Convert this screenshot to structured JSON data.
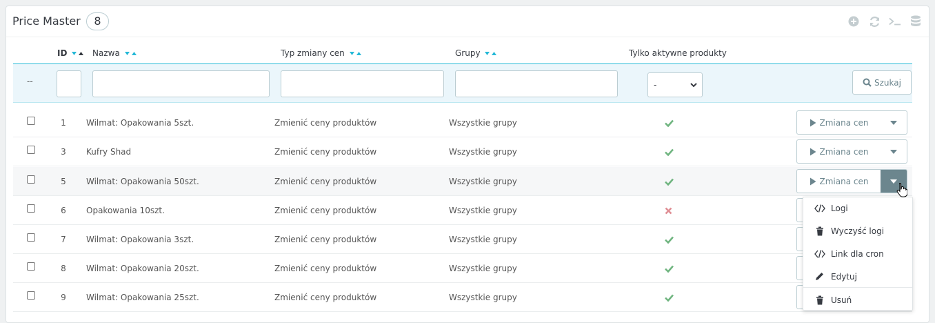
{
  "header": {
    "title": "Price Master",
    "count": "8",
    "toolbar": [
      {
        "name": "add-icon"
      },
      {
        "name": "refresh-icon"
      },
      {
        "name": "terminal-icon"
      },
      {
        "name": "database-icon"
      }
    ]
  },
  "columns": {
    "id": "ID",
    "name": "Nazwa",
    "type": "Typ zmiany cen",
    "groups": "Grupy",
    "active": "Tylko aktywne produkty"
  },
  "filters": {
    "placeholder_dash": "--",
    "id_value": "",
    "name_value": "",
    "type_value": "",
    "groups_value": "",
    "active_selected": "-",
    "search_label": "Szukaj"
  },
  "rows": [
    {
      "id": "1",
      "name": "Wilmat: Opakowania 5szt.",
      "type": "Zmienić ceny produktów",
      "group": "Wszystkie grupy",
      "active": true
    },
    {
      "id": "3",
      "name": "Kufry Shad",
      "type": "Zmienić ceny produktów",
      "group": "Wszystkie grupy",
      "active": true
    },
    {
      "id": "5",
      "name": "Wilmat: Opakowania 50szt.",
      "type": "Zmienić ceny produktów",
      "group": "Wszystkie grupy",
      "active": true
    },
    {
      "id": "6",
      "name": "Opakowania 10szt.",
      "type": "Zmienić ceny produktów",
      "group": "Wszystkie grupy",
      "active": false
    },
    {
      "id": "7",
      "name": "Wilmat: Opakowania 3szt.",
      "type": "Zmienić ceny produktów",
      "group": "Wszystkie grupy",
      "active": true
    },
    {
      "id": "8",
      "name": "Wilmat: Opakowania 20szt.",
      "type": "Zmienić ceny produktów",
      "group": "Wszystkie grupy",
      "active": true
    },
    {
      "id": "9",
      "name": "Wilmat: Opakowania 25szt.",
      "type": "Zmienić ceny produktów",
      "group": "Wszystkie grupy",
      "active": true
    }
  ],
  "row_action_label": "Zmiana cen",
  "dropdown": {
    "items": [
      {
        "label": "Logi",
        "icon": "code-icon"
      },
      {
        "label": "Wyczyść logi",
        "icon": "trash-icon"
      },
      {
        "label": "Link dla cron",
        "icon": "code-icon"
      },
      {
        "label": "Edytuj",
        "icon": "pencil-icon"
      },
      {
        "label": "Usuń",
        "icon": "trash-icon"
      }
    ]
  },
  "colors": {
    "accent": "#25b9d7",
    "success": "#70b580",
    "danger": "#e08f95",
    "muted": "#6c868e"
  }
}
